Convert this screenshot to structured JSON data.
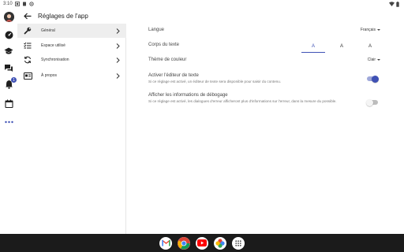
{
  "status": {
    "time": "3:10"
  },
  "header": {
    "title": "Réglages de l'app"
  },
  "rail": {
    "items": [
      "avatar",
      "dashboard-icon",
      "school-icon",
      "chat-icon",
      "notifications-icon",
      "calendar-icon",
      "more-icon"
    ],
    "notification_badge": "1"
  },
  "sidebar": {
    "items": [
      {
        "label": "Général",
        "icon": "wrench-icon",
        "active": true
      },
      {
        "label": "Espace utilisé",
        "icon": "checklist-icon",
        "active": false
      },
      {
        "label": "Synchronisation",
        "icon": "sync-icon",
        "active": false
      },
      {
        "label": "À propos",
        "icon": "info-card-icon",
        "active": false
      }
    ]
  },
  "settings": {
    "language": {
      "label": "Langue",
      "value": "Français"
    },
    "font_size": {
      "label": "Corps du texte",
      "options": [
        "A",
        "A",
        "A"
      ],
      "selected_index": 0
    },
    "theme": {
      "label": "Thème de couleur",
      "value": "Clair"
    },
    "text_editor": {
      "label": "Activer l'éditeur de texte",
      "description": "Si ce réglage est activé, un éditeur de texte sera disponible pour saisir du contenu.",
      "enabled": true
    },
    "debug": {
      "label": "Afficher les informations de débogage",
      "description": "Si ce réglage est activé, les dialogues d'erreur afficheront plus d'informations sur l'erreur, dans la mesure du possible.",
      "enabled": false
    }
  },
  "colors": {
    "accent": "#3f51b5",
    "toggle_on_track": "#9fa8da",
    "toggle_off_track": "#bdbdbd",
    "toggle_off_knob": "#f5f5f5"
  },
  "dock": {
    "apps": [
      "gmail-icon",
      "chrome-icon",
      "youtube-icon",
      "photos-icon",
      "app-grid-icon"
    ]
  }
}
